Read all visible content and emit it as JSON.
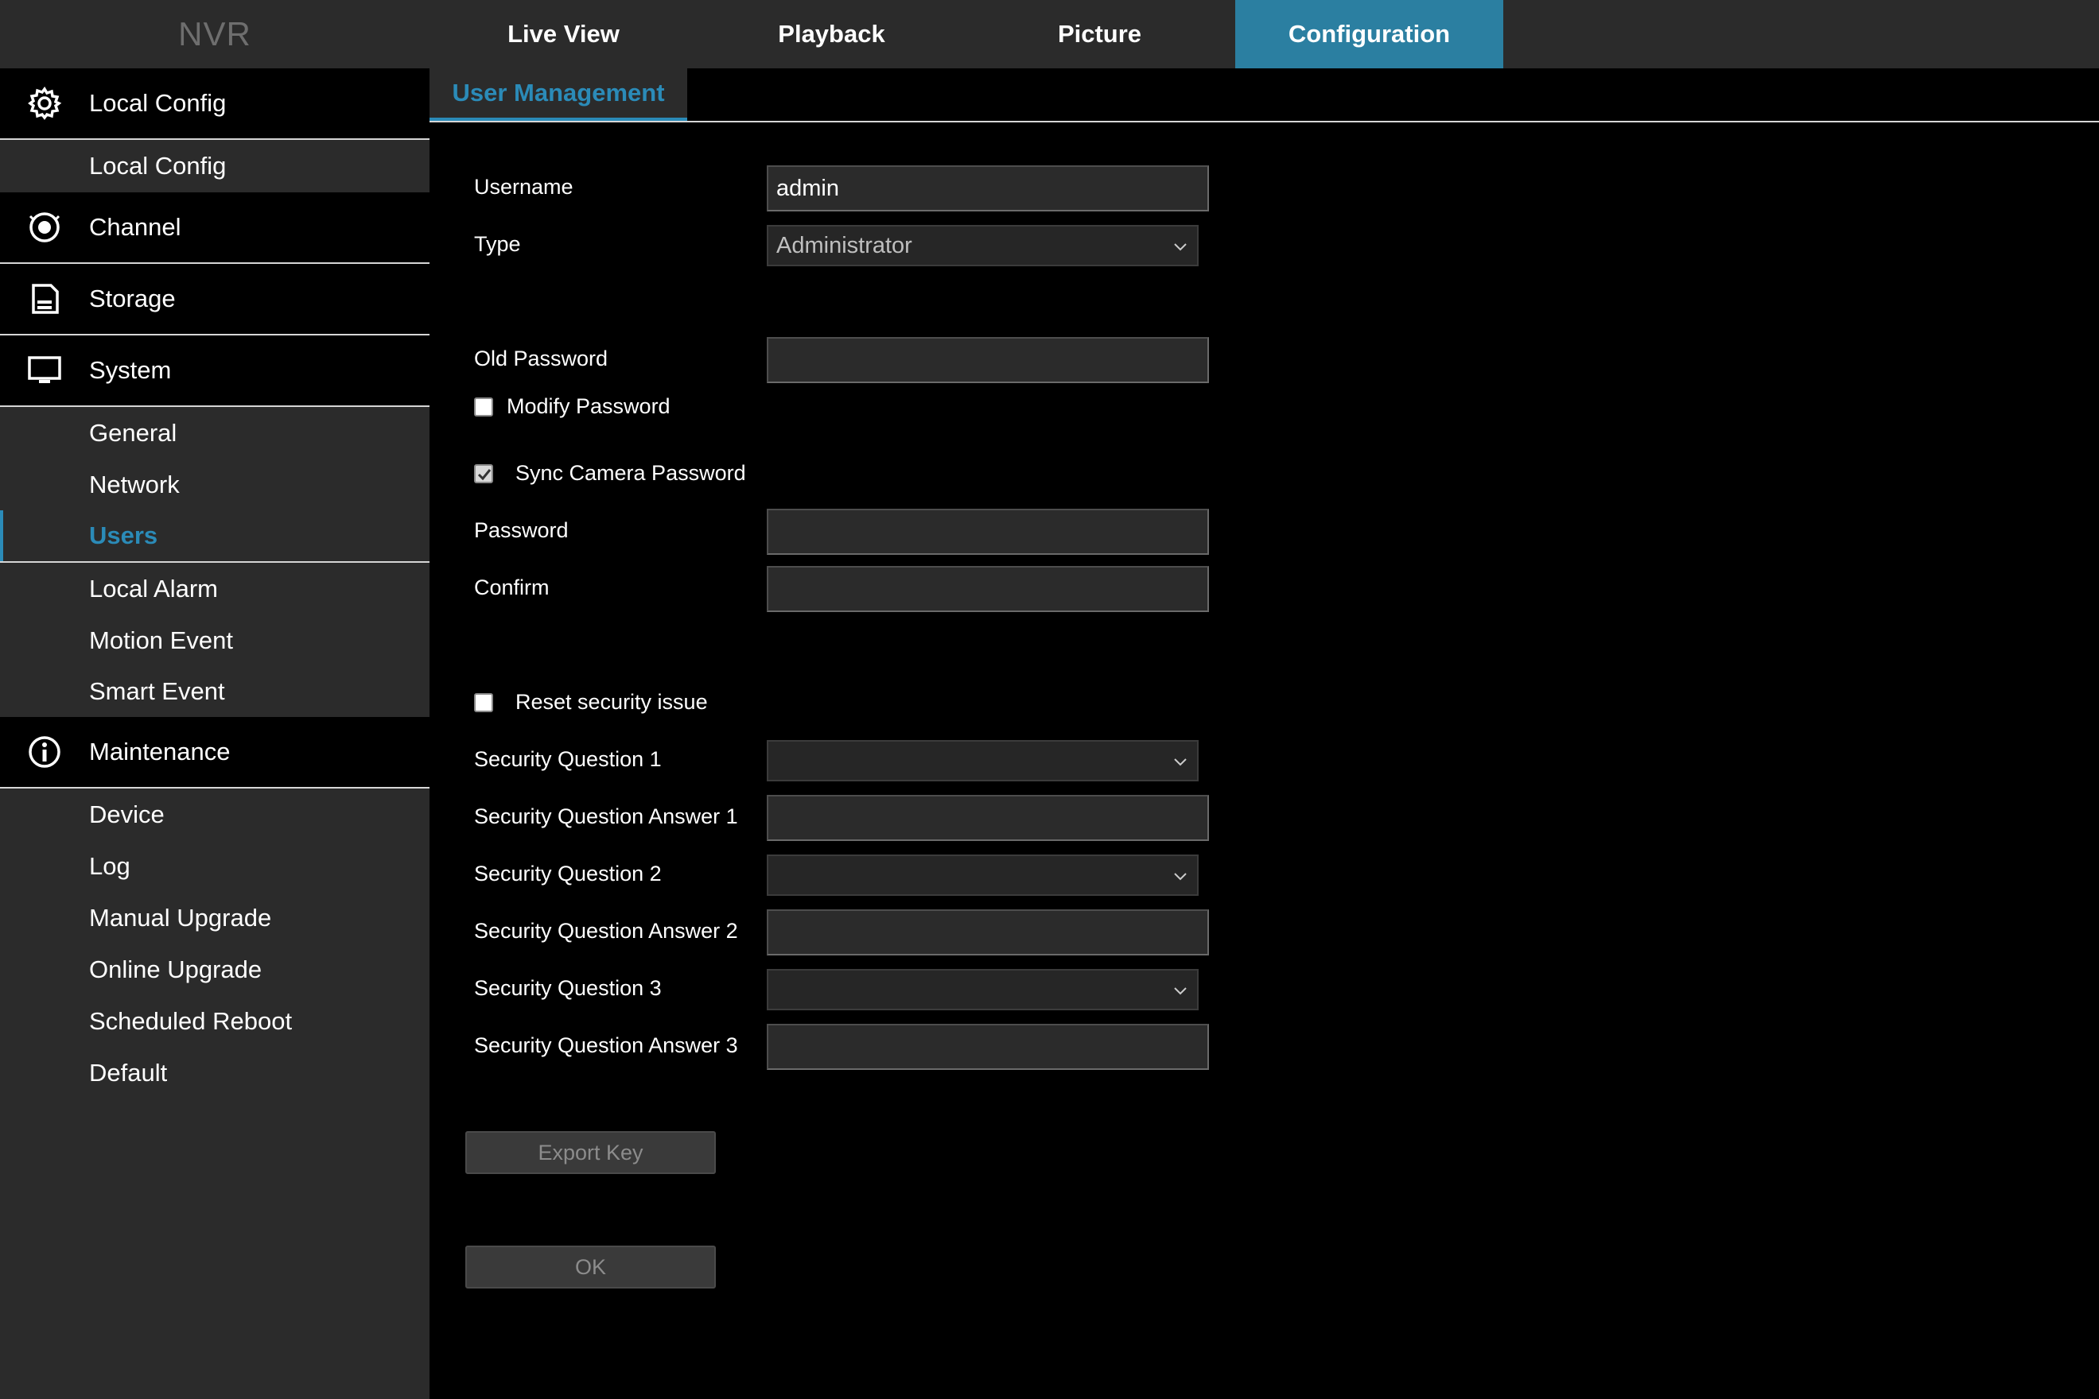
{
  "app": {
    "logo": "NVR"
  },
  "topnav": {
    "tabs": [
      {
        "label": "Live View"
      },
      {
        "label": "Playback"
      },
      {
        "label": "Picture"
      },
      {
        "label": "Configuration"
      }
    ],
    "active": "Configuration"
  },
  "sidebar": {
    "local_config": {
      "label": "Local Config",
      "icon": "gear-icon"
    },
    "local_config_sub": "Local Config",
    "channel": {
      "label": "Channel",
      "icon": "camera-icon"
    },
    "storage": {
      "label": "Storage",
      "icon": "storage-icon"
    },
    "system": {
      "label": "System",
      "icon": "monitor-icon"
    },
    "system_items": [
      "General",
      "Network",
      "Users",
      "Local Alarm",
      "Motion Event",
      "Smart Event"
    ],
    "selected": "Users",
    "maintenance": {
      "label": "Maintenance",
      "icon": "info-icon"
    },
    "maintenance_items": [
      "Device",
      "Log",
      "Manual Upgrade",
      "Online Upgrade",
      "Scheduled Reboot",
      "Default"
    ]
  },
  "content": {
    "subtab": "User Management",
    "username": {
      "label": "Username",
      "value": "admin"
    },
    "type": {
      "label": "Type",
      "value": "Administrator"
    },
    "old_password": {
      "label": "Old Password",
      "value": ""
    },
    "modify_password": {
      "label": "Modify Password",
      "checked": false
    },
    "sync_camera_password": {
      "label": "Sync Camera Password",
      "checked": true
    },
    "password": {
      "label": "Password",
      "value": ""
    },
    "confirm": {
      "label": "Confirm",
      "value": ""
    },
    "reset_security": {
      "label": "Reset security issue",
      "checked": false
    },
    "security": [
      {
        "q_label": "Security Question 1",
        "q_value": "",
        "a_label": "Security Question Answer 1",
        "a_value": ""
      },
      {
        "q_label": "Security Question 2",
        "q_value": "",
        "a_label": "Security Question Answer 2",
        "a_value": ""
      },
      {
        "q_label": "Security Question 3",
        "q_value": "",
        "a_label": "Security Question Answer 3",
        "a_value": ""
      }
    ],
    "export_key": "Export Key",
    "ok": "OK"
  },
  "colors": {
    "accent": "#2b7fa1",
    "accent_text": "#2b8bb8",
    "panel": "#2b2b2b",
    "background": "#000000"
  }
}
